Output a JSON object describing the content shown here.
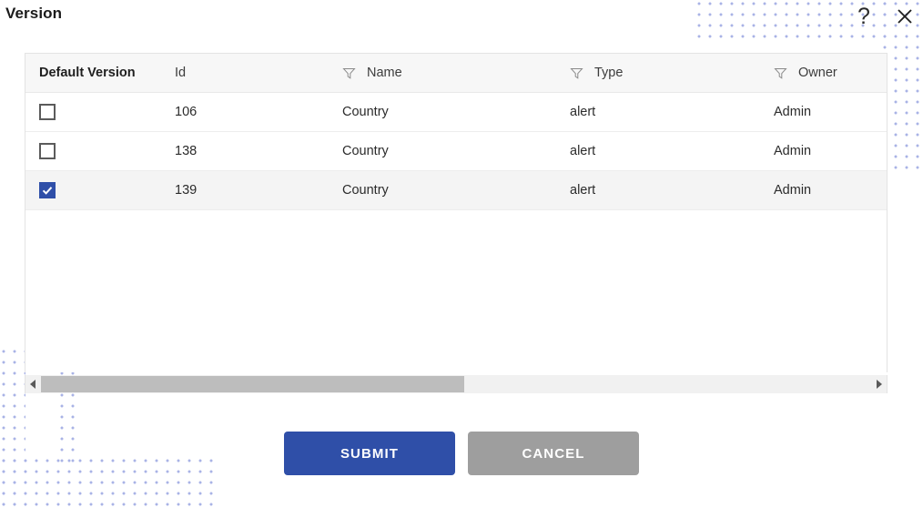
{
  "dialog": {
    "title": "Version",
    "help_icon": "question-mark-icon",
    "close_icon": "close-x-icon"
  },
  "table": {
    "columns": [
      {
        "key": "default_version",
        "label": "Default Version",
        "has_filter": false,
        "bold": true
      },
      {
        "key": "id",
        "label": "Id",
        "has_filter": false,
        "bold": false
      },
      {
        "key": "name",
        "label": "Name",
        "has_filter": true,
        "bold": false
      },
      {
        "key": "type",
        "label": "Type",
        "has_filter": true,
        "bold": false
      },
      {
        "key": "owner",
        "label": "Owner",
        "has_filter": true,
        "bold": false
      }
    ],
    "rows": [
      {
        "default_version": false,
        "id": "106",
        "name": "Country",
        "type": "alert",
        "owner": "Admin",
        "selected": false
      },
      {
        "default_version": false,
        "id": "138",
        "name": "Country",
        "type": "alert",
        "owner": "Admin",
        "selected": false
      },
      {
        "default_version": true,
        "id": "139",
        "name": "Country",
        "type": "alert",
        "owner": "Admin",
        "selected": true
      }
    ]
  },
  "scrollbar": {
    "left_arrow_icon": "caret-left-icon",
    "right_arrow_icon": "caret-right-icon",
    "thumb_width_percent": 51
  },
  "footer": {
    "submit_label": "SUBMIT",
    "cancel_label": "CANCEL"
  },
  "colors": {
    "accent_blue": "#2f4fa8",
    "cancel_gray": "#9e9e9e",
    "header_bg": "#f7f7f7",
    "selected_row_bg": "#f4f4f4",
    "dot_pattern": "#a9b3e6"
  }
}
